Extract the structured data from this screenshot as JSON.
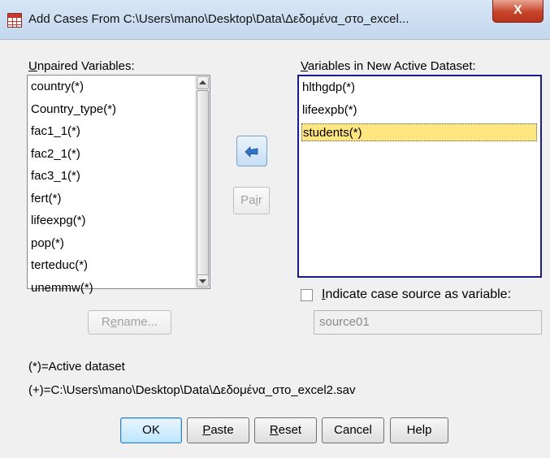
{
  "window": {
    "title": "Add Cases From C:\\Users\\mano\\Desktop\\Data\\Δεδομένα_στο_excel...",
    "close_label": "X"
  },
  "unpaired": {
    "label": "Unpaired Variables:",
    "items": [
      "country(*)",
      "Country_type(*)",
      "fac1_1(*)",
      "fac2_1(*)",
      "fac3_1(*)",
      "fert(*)",
      "lifeexpg(*)",
      "pop(*)",
      "terteduc(*)",
      "unemmw(*)"
    ]
  },
  "new_dataset": {
    "label": "Variables in New Active Dataset:",
    "items": [
      "hlthgdp(*)",
      "lifeexpb(*)",
      "students(*)"
    ],
    "selected_index": 2
  },
  "buttons": {
    "pair": "Pair",
    "rename": "Rename...",
    "ok": "OK",
    "paste": "Paste",
    "reset": "Reset",
    "cancel": "Cancel",
    "help": "Help"
  },
  "indicate": {
    "label": "Indicate case source as variable:",
    "checked": false,
    "field_value": "source01"
  },
  "legend": {
    "active": "(*)=Active dataset",
    "other": "(+)=C:\\Users\\mano\\Desktop\\Data\\Δεδομένα_στο_excel2.sav"
  },
  "colors": {
    "selection_highlight": "#ffe680",
    "arrow_blue": "#2f76c8",
    "close_red": "#c7452b"
  },
  "icons": {
    "move_left": "arrow-left-icon",
    "app": "spss-data-icon"
  }
}
